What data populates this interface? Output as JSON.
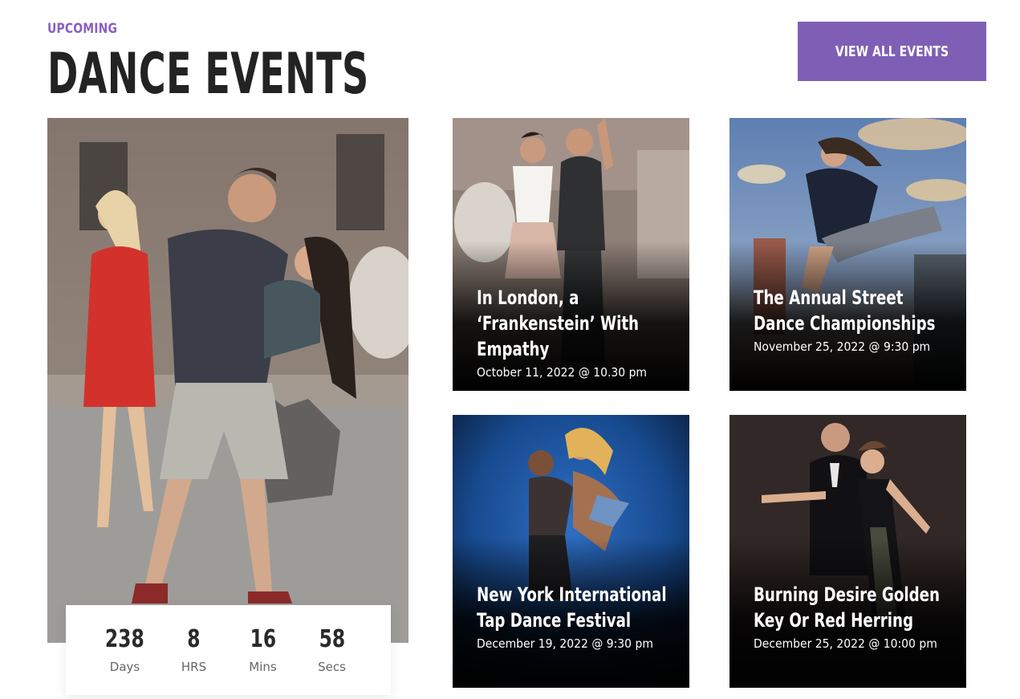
{
  "header": {
    "eyebrow": "UPCOMING",
    "title": "DANCE EVENTS",
    "view_all_label": "VIEW ALL EVENTS"
  },
  "countdown": [
    {
      "value": "238",
      "label": "Days"
    },
    {
      "value": "8",
      "label": "HRS"
    },
    {
      "value": "16",
      "label": "Mins"
    },
    {
      "value": "58",
      "label": "Secs"
    }
  ],
  "events": [
    {
      "title": "In London, a ‘Frankenstein’ With Empathy",
      "date": "October 11, 2022 @ 10.30 pm"
    },
    {
      "title": "The Annual Street Dance Championships",
      "date": "November 25, 2022 @ 9:30 pm"
    },
    {
      "title": "New York International Tap Dance Festival",
      "date": "December 19, 2022 @ 9:30 pm"
    },
    {
      "title": "Burning Desire Golden Key Or Red Herring",
      "date": "December 25, 2022 @ 10:00 pm"
    }
  ],
  "colors": {
    "accent": "#7f5fb5",
    "eyebrow": "#8a5fc2",
    "title": "#232323"
  }
}
